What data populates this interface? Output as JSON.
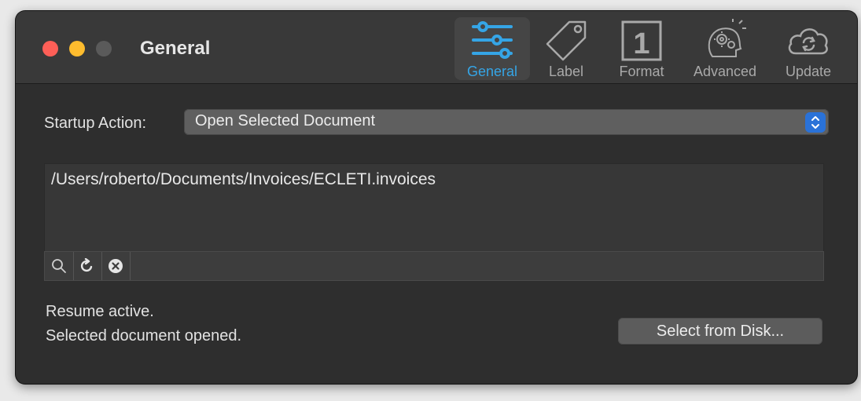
{
  "window": {
    "title": "General"
  },
  "toolbar": {
    "items": [
      {
        "label": "General",
        "icon": "sliders-icon",
        "active": true
      },
      {
        "label": "Label",
        "icon": "tag-icon",
        "active": false
      },
      {
        "label": "Format",
        "icon": "number-one-icon",
        "active": false
      },
      {
        "label": "Advanced",
        "icon": "gears-head-icon",
        "active": false
      },
      {
        "label": "Update",
        "icon": "cloud-sync-icon",
        "active": false
      }
    ],
    "active_color": "#35a5e6"
  },
  "startup": {
    "label": "Startup Action:",
    "selected": "Open Selected Document"
  },
  "document": {
    "path": "/Users/roberto/Documents/Invoices/ECLETI.invoices"
  },
  "pathbar": {
    "buttons": [
      "search-icon",
      "refresh-icon",
      "clear-icon"
    ]
  },
  "status": {
    "line1": "Resume active.",
    "line2": "Selected document opened."
  },
  "buttons": {
    "select_from_disk": "Select from Disk..."
  }
}
